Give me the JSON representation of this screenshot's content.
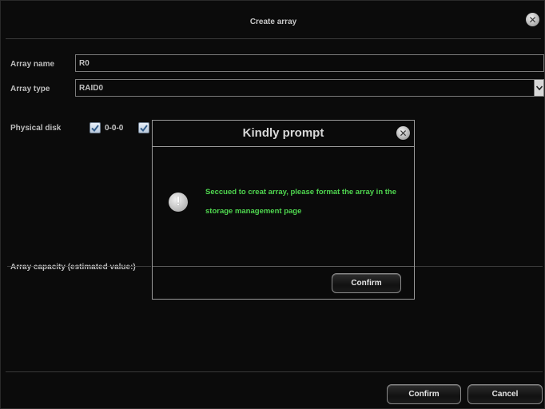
{
  "window": {
    "title": "Create array",
    "close_glyph": "✕"
  },
  "form": {
    "array_name_label": "Array name",
    "array_name_value": "R0",
    "array_type_label": "Array type",
    "array_type_value": "RAID0",
    "physical_disk_label": "Physical disk",
    "disks": [
      {
        "label": "0-0-0",
        "checked": true
      },
      {
        "label": "",
        "checked": true
      }
    ],
    "capacity_label": "Array capacity (estimated value:)"
  },
  "footer": {
    "confirm_label": "Confirm",
    "cancel_label": "Cancel"
  },
  "dialog": {
    "title": "Kindly prompt",
    "close_glyph": "✕",
    "icon": "exclamation-icon",
    "icon_glyph": "!",
    "message": "Seccued to creat array, please format the array in the storage management page",
    "confirm_label": "Confirm",
    "message_color": "#4fd64f"
  }
}
